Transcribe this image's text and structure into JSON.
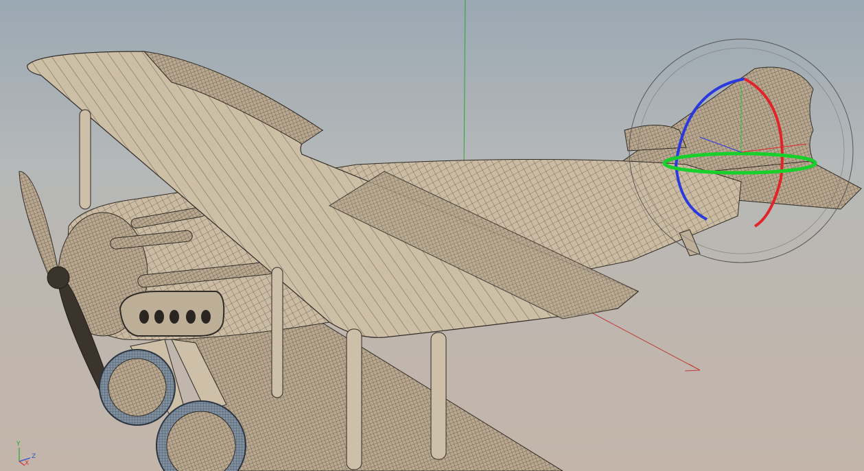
{
  "viewport": {
    "background_top": "#9aa8b3",
    "background_bottom": "#c3b5aa",
    "model_fill": "#cbbba3",
    "wire_color": "#3a342d"
  },
  "gizmo": {
    "type": "rotate",
    "x_color": "#e0242a",
    "y_color": "#18d02c",
    "z_color": "#2a3adf",
    "outer_ring_color": "#555555"
  },
  "world_axes": {
    "y_color": "#2aa53a",
    "x_color": "#c03a3a"
  },
  "axis_triad": {
    "y_label": "Y",
    "z_label": "Z",
    "x_label": "X",
    "y_color": "#29a82f",
    "z_color": "#3050d0",
    "x_color": "#d03030"
  }
}
